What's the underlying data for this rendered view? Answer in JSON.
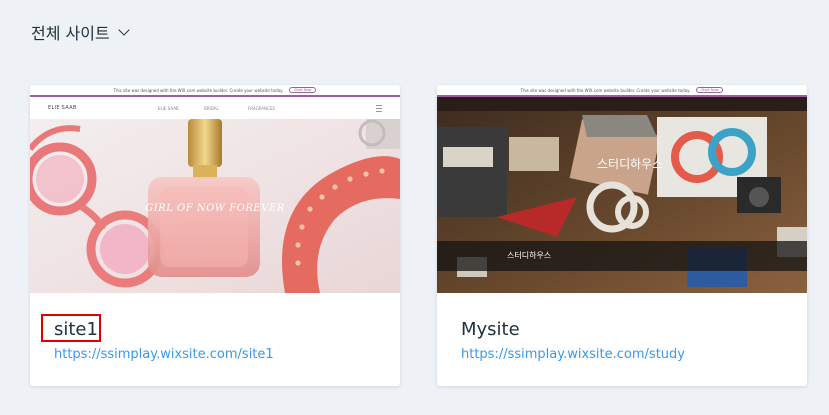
{
  "filter": {
    "label": "전체 사이트"
  },
  "sites": [
    {
      "name": "site1",
      "url": "https://ssimplay.wixsite.com/site1",
      "thumb": {
        "banner_text": "This site was designed with the WIX.com website builder. Create your website today.",
        "banner_button": "Start Now",
        "brand": "ELIE SAAB",
        "nav": [
          "ELIE SAAB",
          "BRIDAL",
          "FRAGRANCES"
        ],
        "tagline": "GIRL OF NOW FOREVER"
      }
    },
    {
      "name": "Mysite",
      "url": "https://ssimplay.wixsite.com/study",
      "thumb": {
        "banner_text": "This site was designed with the WIX.com website builder. Create your website today.",
        "banner_button": "Start Now",
        "band_title": "스터디하우스",
        "overlay": "스터디하우스"
      }
    }
  ],
  "colors": {
    "accent": "#3899ec",
    "highlight": "#e00000",
    "banner": "#9c5fa3"
  }
}
